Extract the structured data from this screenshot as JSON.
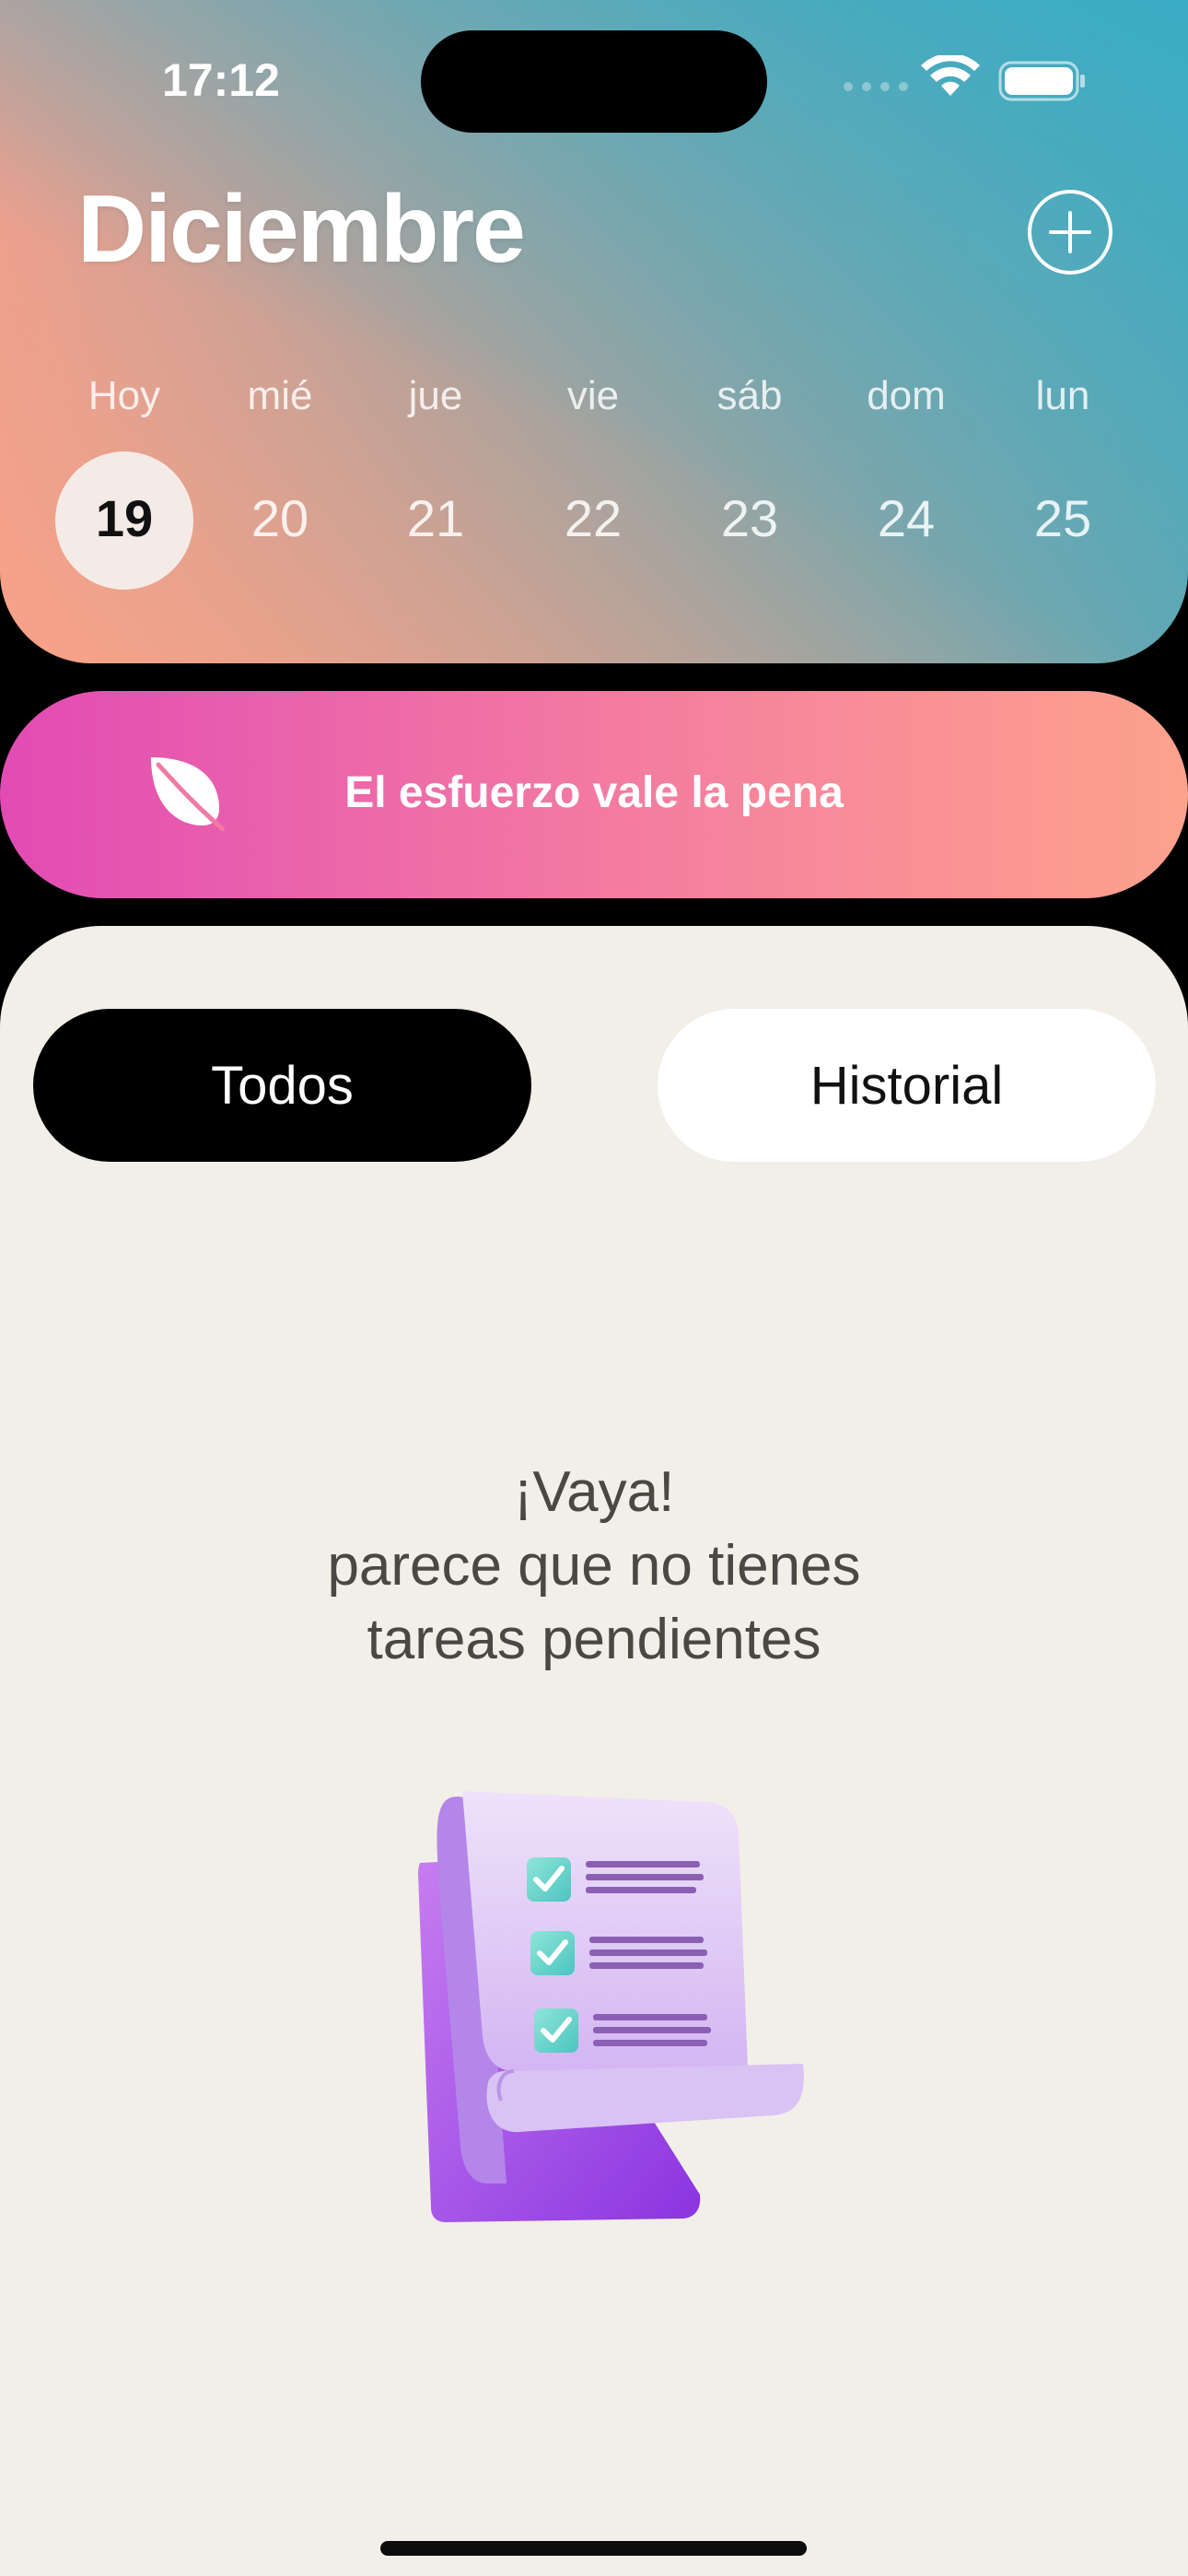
{
  "status_bar": {
    "time": "17:12"
  },
  "header": {
    "month": "Diciembre",
    "add_icon": "plus-circle-icon",
    "days": [
      {
        "label": "Hoy",
        "number": "19",
        "selected": true
      },
      {
        "label": "mié",
        "number": "20",
        "selected": false
      },
      {
        "label": "jue",
        "number": "21",
        "selected": false
      },
      {
        "label": "vie",
        "number": "22",
        "selected": false
      },
      {
        "label": "sáb",
        "number": "23",
        "selected": false
      },
      {
        "label": "dom",
        "number": "24",
        "selected": false
      },
      {
        "label": "lun",
        "number": "25",
        "selected": false
      }
    ]
  },
  "banner": {
    "icon": "leaf-icon",
    "text": "El esfuerzo vale la pena"
  },
  "tabs": [
    {
      "label": "Todos",
      "active": true
    },
    {
      "label": "Historial",
      "active": false
    }
  ],
  "empty_state": {
    "lines": [
      "¡Vaya!",
      "parece que no tienes",
      "tareas pendientes"
    ],
    "illustration": "checklist-scroll-illustration"
  },
  "colors": {
    "accent_dark": "#000000",
    "content_bg": "#f2efe8",
    "banner_start": "#e24bb4",
    "banner_end": "#fda28c",
    "header_teal": "#3aacc4",
    "header_peach": "#faa286"
  }
}
